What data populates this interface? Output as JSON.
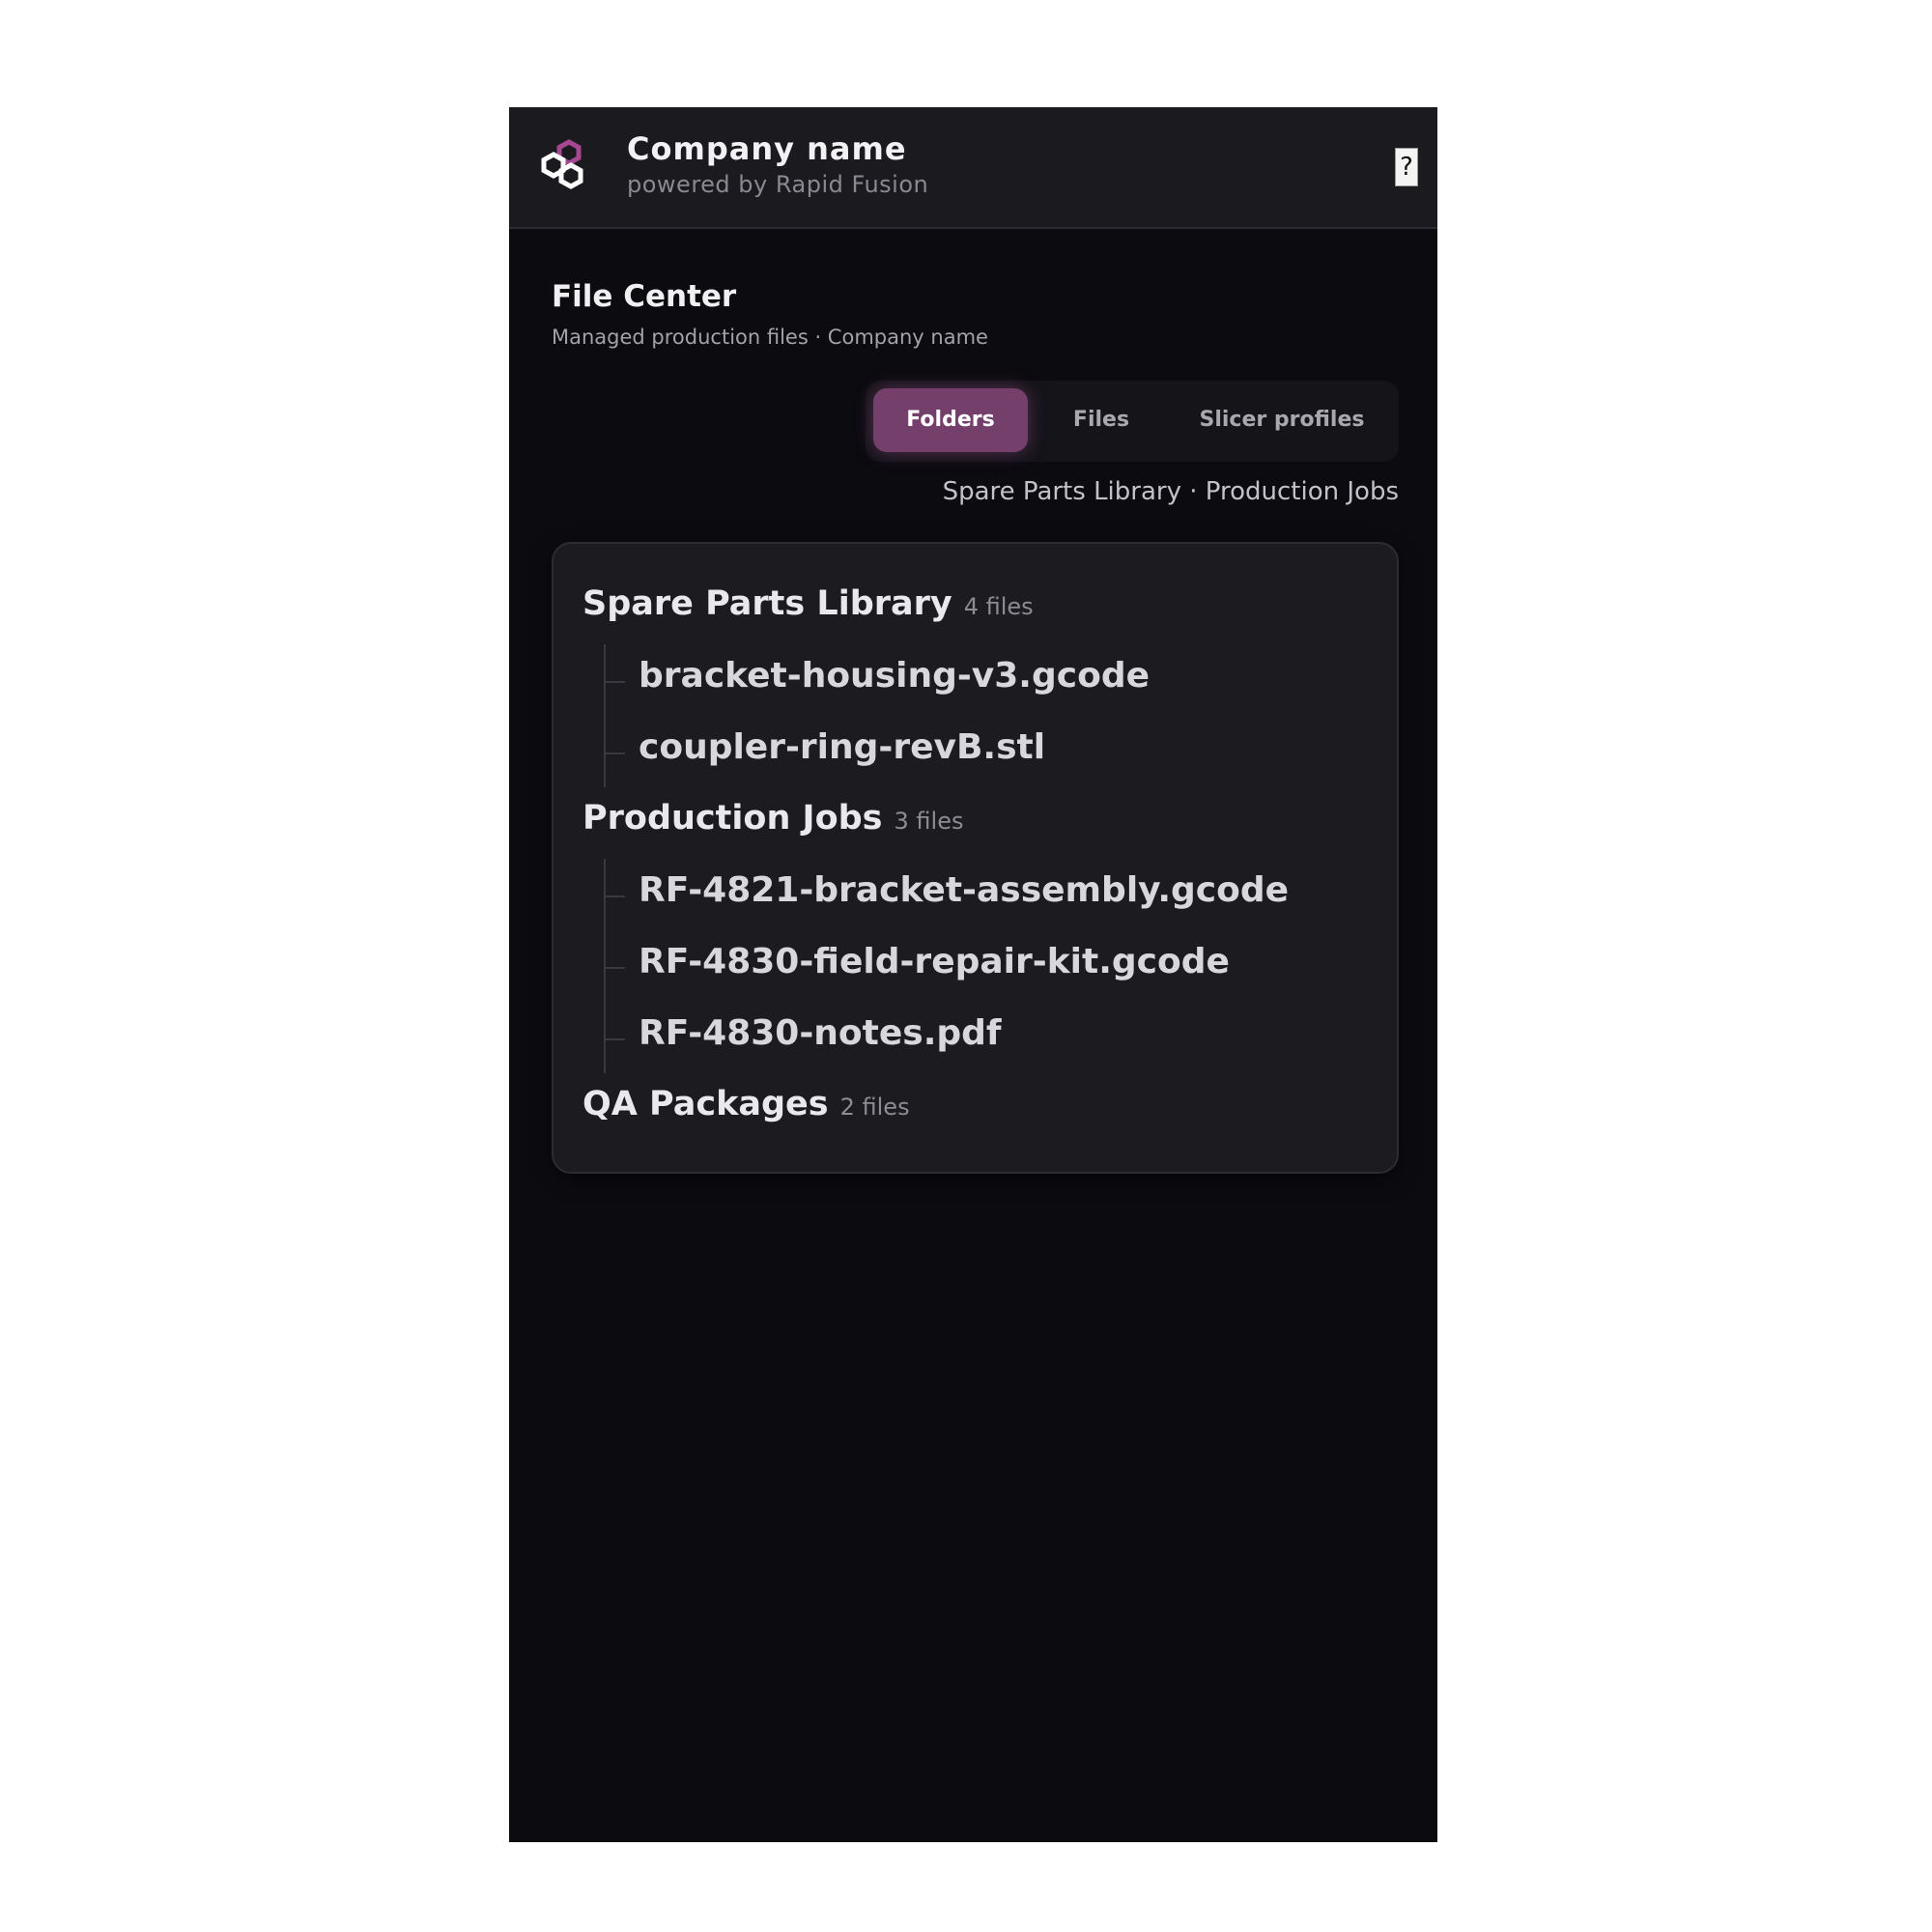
{
  "header": {
    "company_name": "Company name",
    "powered_by": "powered by Rapid Fusion",
    "help_label": "?",
    "logo_icon": "hexagon-logo-icon"
  },
  "page": {
    "title": "File Center",
    "subtitle": "Managed production files · Company name"
  },
  "tabs": [
    {
      "label": "Folders",
      "active": true
    },
    {
      "label": "Files",
      "active": false
    },
    {
      "label": "Slicer profiles",
      "active": false
    }
  ],
  "breadcrumb": "Spare Parts Library · Production Jobs",
  "folders": [
    {
      "name": "Spare Parts Library",
      "count": "4 files",
      "files": [
        "bracket-housing-v3.gcode",
        "coupler-ring-revB.stl"
      ]
    },
    {
      "name": "Production Jobs",
      "count": "3 files",
      "files": [
        "RF-4821-bracket-assembly.gcode",
        "RF-4830-field-repair-kit.gcode",
        "RF-4830-notes.pdf"
      ]
    },
    {
      "name": "QA Packages",
      "count": "2 files",
      "files": []
    }
  ],
  "colors": {
    "accent": "#74406b",
    "logo_accent": "#a5488f",
    "background": "#0c0b10",
    "header_bg": "#1b1a1f",
    "card_bg": "#1c1b20"
  }
}
